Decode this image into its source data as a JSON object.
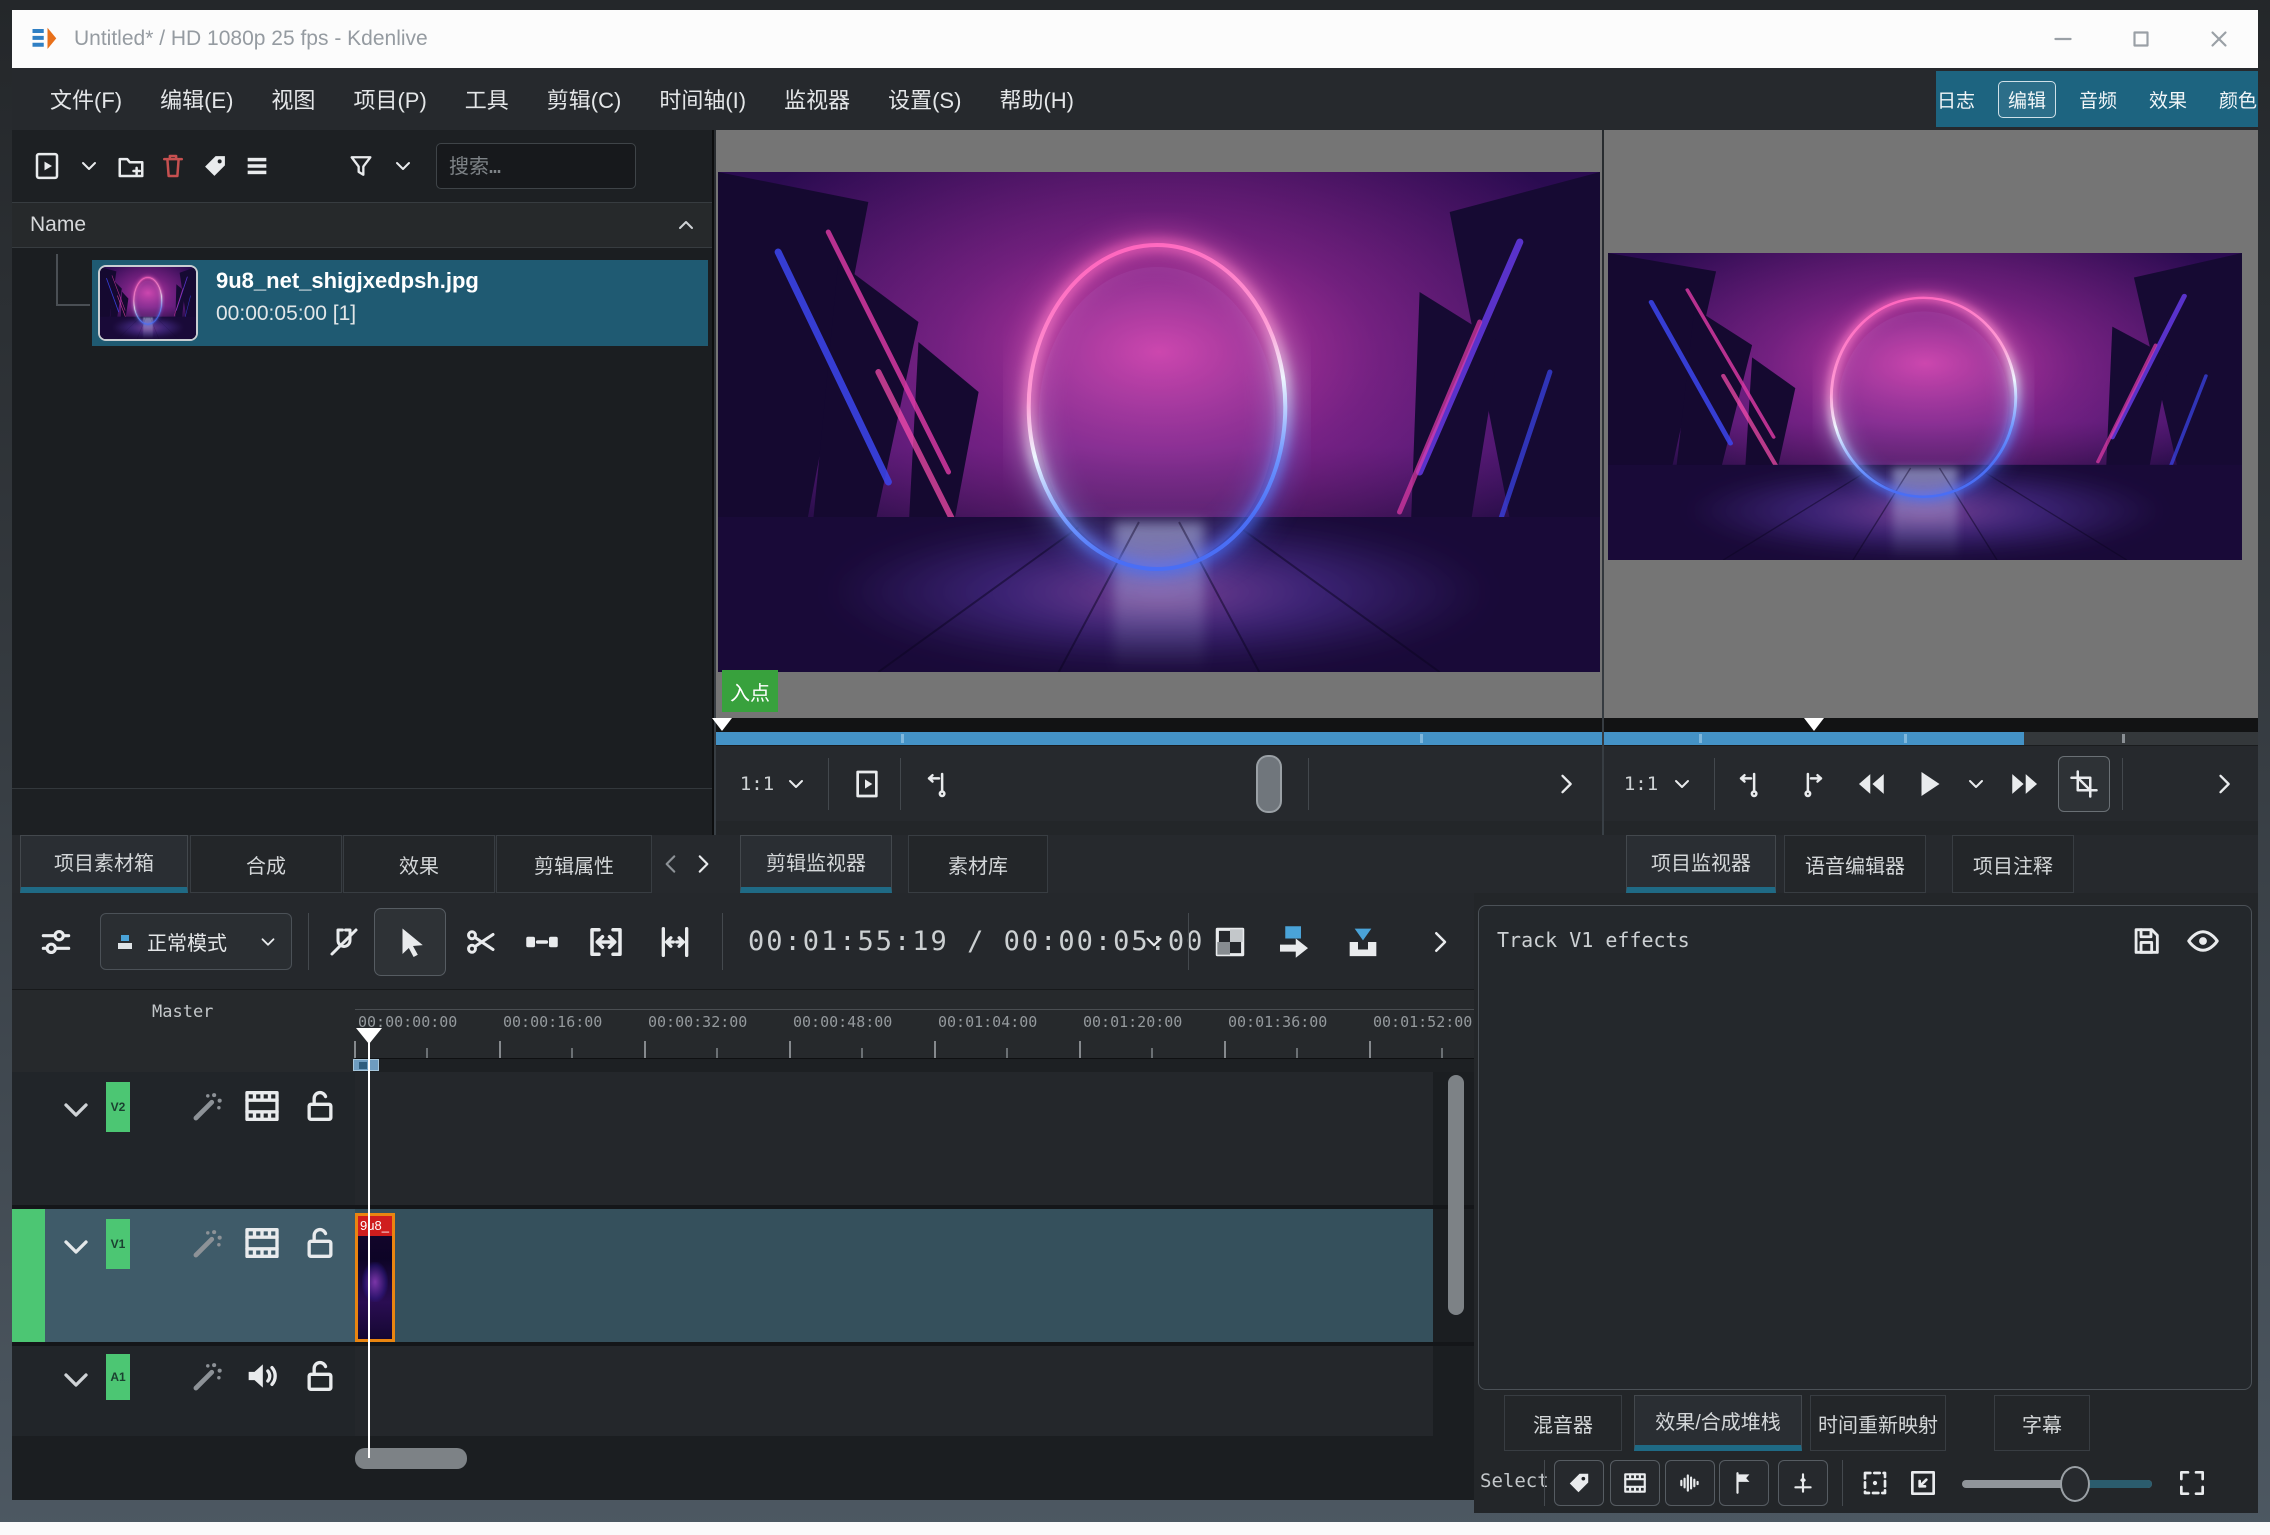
{
  "window": {
    "title": "Untitled* / HD 1080p 25 fps - Kdenlive"
  },
  "menu": {
    "items": [
      "文件(F)",
      "编辑(E)",
      "视图",
      "项目(P)",
      "工具",
      "剪辑(C)",
      "时间轴(I)",
      "监视器",
      "设置(S)",
      "帮助(H)"
    ]
  },
  "workspace": {
    "items": [
      "日志",
      "编辑",
      "音频",
      "效果",
      "颜色"
    ],
    "active": "编辑"
  },
  "bin": {
    "search_placeholder": "搜索…",
    "column_header": "Name",
    "clip": {
      "name": "9u8_net_shigjxedpsh.jpg",
      "duration": "00:00:05:00 [1]"
    }
  },
  "tabs": {
    "left": [
      "项目素材箱",
      "合成",
      "效果",
      "剪辑属性"
    ],
    "left_active": "项目素材箱",
    "monitor": [
      "剪辑监视器",
      "素材库"
    ],
    "monitor_active": "剪辑监视器",
    "right": [
      "项目监视器",
      "语音编辑器",
      "项目注释"
    ],
    "right_active": "项目监视器"
  },
  "clip_monitor": {
    "in_point_label": "入点",
    "zoom_level": "1:1"
  },
  "project_monitor": {
    "zoom_level": "1:1"
  },
  "timeline": {
    "mode_label": "正常模式",
    "timecode": "00:01:55:19 / 00:00:05:00",
    "master_label": "Master",
    "ruler_labels": [
      "00:00:00:00",
      "00:00:16:00",
      "00:00:32:00",
      "00:00:48:00",
      "00:01:04:00",
      "00:01:20:00",
      "00:01:36:00",
      "00:01:52:00"
    ],
    "tracks": [
      {
        "id": "V2"
      },
      {
        "id": "V1"
      },
      {
        "id": "A1"
      }
    ],
    "active_track": "V1",
    "clip_label": "9u8_"
  },
  "effects_panel": {
    "title": "Track V1 effects",
    "tabs": [
      "混音器",
      "效果/合成堆栈",
      "时间重新映射",
      "字幕"
    ],
    "active_tab": "效果/合成堆栈",
    "select_label": "Select"
  },
  "colors": {
    "accent_teal": "#1d6480",
    "bin_selection": "#1f5a72",
    "active_track": "#3f5b69",
    "track_tag_green": "#4cc673",
    "clip_border_orange": "#ea8510",
    "clip_label_red": "#cf1d1d",
    "monitor_zoom_bar": "#4492c6",
    "in_point_badge_green": "#38a13d"
  },
  "icons": [
    "kdenlive-logo",
    "minimize",
    "maximize",
    "close",
    "add-clip",
    "chevron-down",
    "create-folder",
    "delete",
    "tag",
    "menu",
    "filter",
    "search",
    "chevron-up",
    "clip-monitor",
    "zone-in",
    "zone-out",
    "rewind",
    "play",
    "fast-forward",
    "crop",
    "volume-slider",
    "chevron-right",
    "chevron-left",
    "adjust",
    "snap-off",
    "selection-tool",
    "razor",
    "spacer",
    "fit-zoom",
    "split",
    "mix",
    "insert",
    "overwrite",
    "magic-wand",
    "filmstrip",
    "speaker",
    "lock-open",
    "save",
    "eye",
    "audio-wave",
    "flag",
    "keyframes",
    "zoom-fit",
    "zoom-corner",
    "expand"
  ]
}
